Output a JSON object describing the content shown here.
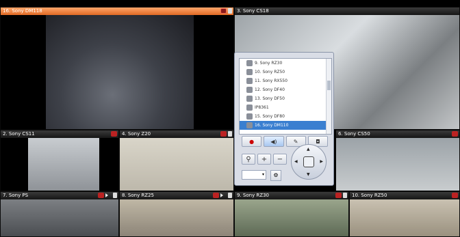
{
  "tiles": [
    {
      "title": "16. Sony DM118",
      "active": true
    },
    {
      "title": "3. Sony CS18"
    },
    {
      "title": "2. Sony CS11"
    },
    {
      "title": "4. Sony Z20"
    },
    {
      "title": "6. Sony CS50"
    },
    {
      "title": "7. Sony PS"
    },
    {
      "title": "8. Sony RZ25"
    },
    {
      "title": "9. Sony RZ30"
    },
    {
      "title": "10. Sony RZ50"
    }
  ],
  "camera_list": [
    {
      "label": "9. Sony RZ30"
    },
    {
      "label": "10. Sony RZ50"
    },
    {
      "label": "11. Sony RX550"
    },
    {
      "label": "12. Sony DF40"
    },
    {
      "label": "13. Sony DF50"
    },
    {
      "label": "IP8361"
    },
    {
      "label": "15. Sony DF80"
    },
    {
      "label": "16. Sony DM110",
      "selected": true
    }
  ],
  "panel": {
    "tools": [
      "●",
      "◀)",
      "✎",
      "◘"
    ],
    "zoom": [
      "⚲",
      "+",
      "−"
    ],
    "arrows": [
      "▲",
      "▼",
      "◀",
      "▶"
    ],
    "combo_arrow": "▾",
    "gear": "⚙"
  }
}
